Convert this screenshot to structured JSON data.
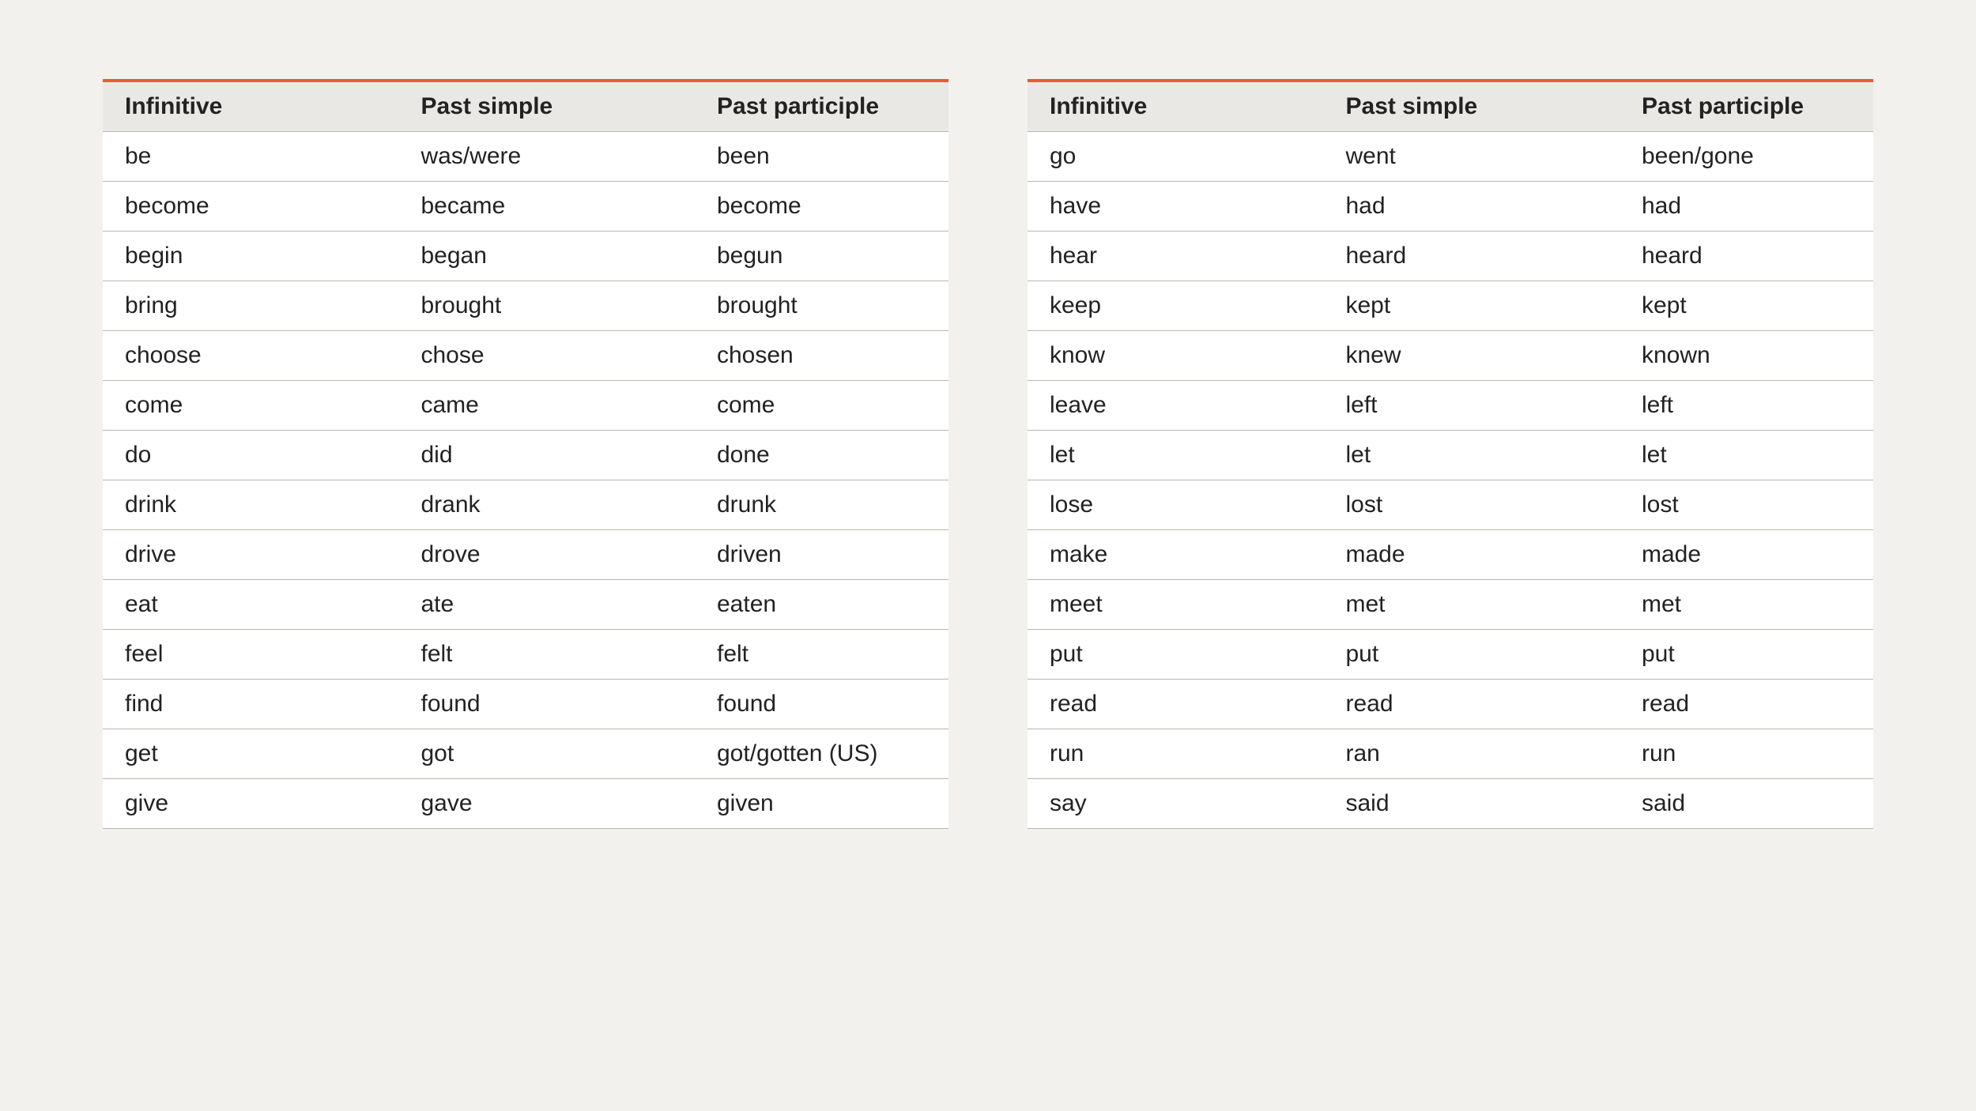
{
  "tables": {
    "headers": [
      "Infinitive",
      "Past simple",
      "Past participle"
    ],
    "left": [
      [
        "be",
        "was/were",
        "been"
      ],
      [
        "become",
        "became",
        "become"
      ],
      [
        "begin",
        "began",
        "begun"
      ],
      [
        "bring",
        "brought",
        "brought"
      ],
      [
        "choose",
        "chose",
        "chosen"
      ],
      [
        "come",
        "came",
        "come"
      ],
      [
        "do",
        "did",
        "done"
      ],
      [
        "drink",
        "drank",
        "drunk"
      ],
      [
        "drive",
        "drove",
        "driven"
      ],
      [
        "eat",
        "ate",
        "eaten"
      ],
      [
        "feel",
        "felt",
        "felt"
      ],
      [
        "find",
        "found",
        "found"
      ],
      [
        "get",
        "got",
        "got/gotten (US)"
      ],
      [
        "give",
        "gave",
        "given"
      ]
    ],
    "right": [
      [
        "go",
        "went",
        "been/gone"
      ],
      [
        "have",
        "had",
        "had"
      ],
      [
        "hear",
        "heard",
        "heard"
      ],
      [
        "keep",
        "kept",
        "kept"
      ],
      [
        "know",
        "knew",
        "known"
      ],
      [
        "leave",
        "left",
        "left"
      ],
      [
        "let",
        "let",
        "let"
      ],
      [
        "lose",
        "lost",
        "lost"
      ],
      [
        "make",
        "made",
        "made"
      ],
      [
        "meet",
        "met",
        "met"
      ],
      [
        "put",
        "put",
        "put"
      ],
      [
        "read",
        "read",
        "read"
      ],
      [
        "run",
        "ran",
        "run"
      ],
      [
        "say",
        "said",
        "said"
      ]
    ]
  }
}
